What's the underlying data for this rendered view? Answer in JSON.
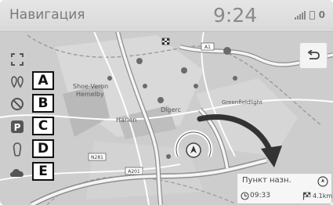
{
  "status_bar": {
    "title": "Навигация",
    "clock": "9:24",
    "icons": [
      "signal-icon",
      "phone-icon",
      "count"
    ],
    "count": "0"
  },
  "side_menu": [
    {
      "icon": "expand-map-icon",
      "label": ""
    },
    {
      "icon": "map-pins-icon",
      "label": "A"
    },
    {
      "icon": "avoid-icon",
      "label": "B"
    },
    {
      "icon": "parking-icon",
      "label": "C"
    },
    {
      "icon": "fuel-icon",
      "label": "D"
    },
    {
      "icon": "weather-icon",
      "label": "E"
    }
  ],
  "back_button": {
    "icon": "back-arrow-icon"
  },
  "map": {
    "place_labels": [
      "Shoe-Veron",
      "Hemelby",
      "Harlen",
      "Dlgerc",
      "Greenfieldlight"
    ],
    "road_shields": [
      "A1",
      "N281",
      "A201"
    ]
  },
  "destination_panel": {
    "title": "Пункт назн.",
    "eta": "09:33",
    "distance": "4.1km",
    "icons": [
      "compass-icon",
      "clock-icon",
      "checkered-flag-icon"
    ]
  }
}
